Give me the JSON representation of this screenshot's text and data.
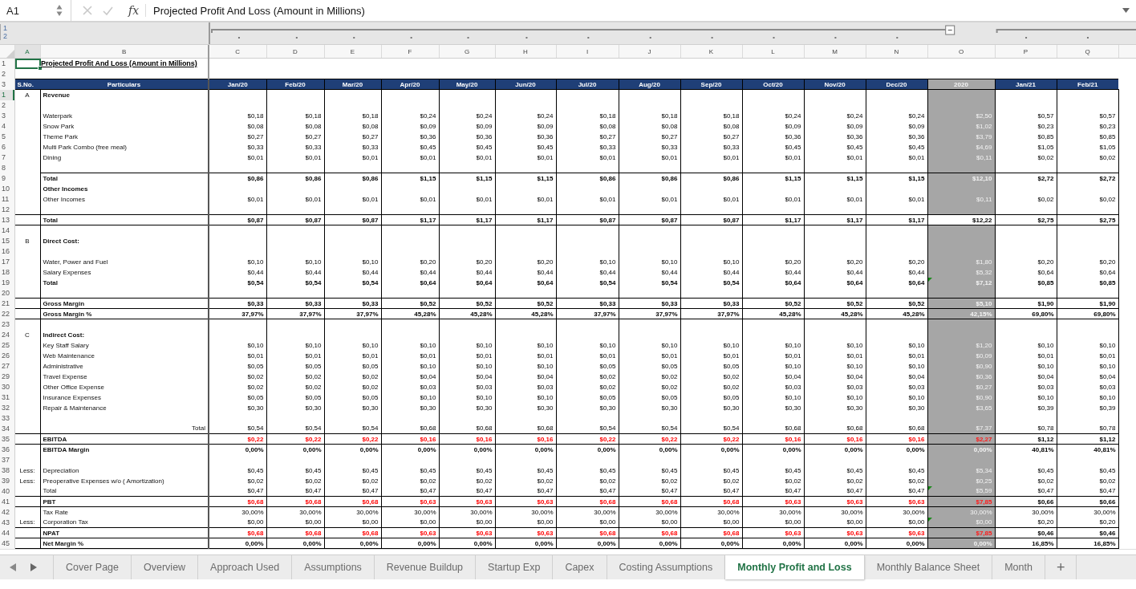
{
  "formula_bar": {
    "cell_ref": "A1",
    "function_label": "fx",
    "formula": "Projected Profit And Loss (Amount in Millions)"
  },
  "outline": {
    "levels": [
      "1",
      "2"
    ]
  },
  "columns": [
    {
      "letter": "A",
      "selected": true
    },
    {
      "letter": "B",
      "selected": false
    },
    {
      "letter": "C",
      "selected": false
    },
    {
      "letter": "D",
      "selected": false
    },
    {
      "letter": "E",
      "selected": false
    },
    {
      "letter": "F",
      "selected": false
    },
    {
      "letter": "G",
      "selected": false
    },
    {
      "letter": "H",
      "selected": false
    },
    {
      "letter": "I",
      "selected": false
    },
    {
      "letter": "J",
      "selected": false
    },
    {
      "letter": "K",
      "selected": false
    },
    {
      "letter": "L",
      "selected": false
    },
    {
      "letter": "M",
      "selected": false
    },
    {
      "letter": "N",
      "selected": false
    },
    {
      "letter": "O",
      "selected": false
    },
    {
      "letter": "P",
      "selected": false
    },
    {
      "letter": "Q",
      "selected": false
    }
  ],
  "value_columns": [
    {
      "header": "Jan/20",
      "shaded": false
    },
    {
      "header": "Feb/20",
      "shaded": false
    },
    {
      "header": "Mar/20",
      "shaded": false
    },
    {
      "header": "Apr/20",
      "shaded": false
    },
    {
      "header": "May/20",
      "shaded": false
    },
    {
      "header": "Jun/20",
      "shaded": false
    },
    {
      "header": "Jul/20",
      "shaded": false
    },
    {
      "header": "Aug/20",
      "shaded": false
    },
    {
      "header": "Sep/20",
      "shaded": false
    },
    {
      "header": "Oct/20",
      "shaded": false
    },
    {
      "header": "Nov/20",
      "shaded": false
    },
    {
      "header": "Dec/20",
      "shaded": false
    },
    {
      "header": "2020",
      "shaded": true
    },
    {
      "header": "Jan/21",
      "shaded": false
    },
    {
      "header": "Feb/21",
      "shaded": false
    }
  ],
  "rows": [
    {
      "row": "1",
      "kind": "title",
      "label": "Projected Profit And Loss (Amount in Millions)",
      "selected": false
    },
    {
      "row": "2",
      "kind": "spacer",
      "selected": false
    },
    {
      "row": "3",
      "kind": "header",
      "sno": "S.No.",
      "label": "Particulars",
      "selected": false
    },
    {
      "row": "1",
      "kind": "section",
      "sno": "A",
      "label": "Revenue",
      "selected": true
    },
    {
      "row": "2",
      "kind": "blank",
      "selected": false
    },
    {
      "row": "3",
      "kind": "item",
      "label": "Waterpark",
      "selected": false,
      "flagged": false,
      "values": [
        "$0,18",
        "$0,18",
        "$0,18",
        "$0,24",
        "$0,24",
        "$0,24",
        "$0,18",
        "$0,18",
        "$0,18",
        "$0,24",
        "$0,24",
        "$0,24",
        "$2,50",
        "$0,57",
        "$0,57"
      ]
    },
    {
      "row": "4",
      "kind": "item",
      "label": "Snow Park",
      "selected": false,
      "flagged": false,
      "values": [
        "$0,08",
        "$0,08",
        "$0,08",
        "$0,09",
        "$0,09",
        "$0,09",
        "$0,08",
        "$0,08",
        "$0,08",
        "$0,09",
        "$0,09",
        "$0,09",
        "$1,02",
        "$0,23",
        "$0,23"
      ]
    },
    {
      "row": "5",
      "kind": "item",
      "label": "Theme Park",
      "selected": false,
      "flagged": false,
      "values": [
        "$0,27",
        "$0,27",
        "$0,27",
        "$0,36",
        "$0,36",
        "$0,36",
        "$0,27",
        "$0,27",
        "$0,27",
        "$0,36",
        "$0,36",
        "$0,36",
        "$3,79",
        "$0,85",
        "$0,85"
      ]
    },
    {
      "row": "6",
      "kind": "item",
      "label": "Multi Park Combo (free meal)",
      "selected": false,
      "flagged": false,
      "values": [
        "$0,33",
        "$0,33",
        "$0,33",
        "$0,45",
        "$0,45",
        "$0,45",
        "$0,33",
        "$0,33",
        "$0,33",
        "$0,45",
        "$0,45",
        "$0,45",
        "$4,69",
        "$1,05",
        "$1,05"
      ]
    },
    {
      "row": "7",
      "kind": "item",
      "label": "Dining",
      "selected": false,
      "flagged": false,
      "values": [
        "$0,01",
        "$0,01",
        "$0,01",
        "$0,01",
        "$0,01",
        "$0,01",
        "$0,01",
        "$0,01",
        "$0,01",
        "$0,01",
        "$0,01",
        "$0,01",
        "$0,11",
        "$0,02",
        "$0,02"
      ]
    },
    {
      "row": "8",
      "kind": "blank",
      "selected": false
    },
    {
      "row": "9",
      "kind": "subtotal",
      "label": "Total",
      "selected": false,
      "flagged": false,
      "values": [
        "$0,86",
        "$0,86",
        "$0,86",
        "$1,15",
        "$1,15",
        "$1,15",
        "$0,86",
        "$0,86",
        "$0,86",
        "$1,15",
        "$1,15",
        "$1,15",
        "$12,10",
        "$2,72",
        "$2,72"
      ]
    },
    {
      "row": "10",
      "kind": "section",
      "label": "Other Incomes",
      "selected": false
    },
    {
      "row": "11",
      "kind": "item",
      "label": "Other Incomes",
      "selected": false,
      "flagged": false,
      "values": [
        "$0,01",
        "$0,01",
        "$0,01",
        "$0,01",
        "$0,01",
        "$0,01",
        "$0,01",
        "$0,01",
        "$0,01",
        "$0,01",
        "$0,01",
        "$0,01",
        "$0,11",
        "$0,02",
        "$0,02"
      ]
    },
    {
      "row": "12",
      "kind": "blank",
      "selected": false
    },
    {
      "row": "13",
      "kind": "grand_total",
      "label": "Total",
      "selected": false,
      "flagged": false,
      "values": [
        "$0,87",
        "$0,87",
        "$0,87",
        "$1,17",
        "$1,17",
        "$1,17",
        "$0,87",
        "$0,87",
        "$0,87",
        "$1,17",
        "$1,17",
        "$1,17",
        "$12,22",
        "$2,75",
        "$2,75"
      ]
    },
    {
      "row": "14",
      "kind": "blank",
      "selected": false
    },
    {
      "row": "15",
      "kind": "section",
      "sno": "B",
      "label": "Direct Cost:",
      "selected": false
    },
    {
      "row": "16",
      "kind": "blank",
      "selected": false
    },
    {
      "row": "17",
      "kind": "item",
      "label": "Water, Power and Fuel",
      "selected": false,
      "flagged": false,
      "values": [
        "$0,10",
        "$0,10",
        "$0,10",
        "$0,20",
        "$0,20",
        "$0,20",
        "$0,10",
        "$0,10",
        "$0,10",
        "$0,20",
        "$0,20",
        "$0,20",
        "$1,80",
        "$0,20",
        "$0,20"
      ]
    },
    {
      "row": "18",
      "kind": "item",
      "label": "Salary Expenses",
      "selected": false,
      "flagged": false,
      "values": [
        "$0,44",
        "$0,44",
        "$0,44",
        "$0,44",
        "$0,44",
        "$0,44",
        "$0,44",
        "$0,44",
        "$0,44",
        "$0,44",
        "$0,44",
        "$0,44",
        "$5,32",
        "$0,64",
        "$0,64"
      ]
    },
    {
      "row": "19",
      "kind": "sum",
      "label": "Total",
      "selected": false,
      "flagged": true,
      "values": [
        "$0,54",
        "$0,54",
        "$0,54",
        "$0,64",
        "$0,64",
        "$0,64",
        "$0,54",
        "$0,54",
        "$0,54",
        "$0,64",
        "$0,64",
        "$0,64",
        "$7,12",
        "$0,85",
        "$0,85"
      ]
    },
    {
      "row": "20",
      "kind": "blank",
      "selected": false
    },
    {
      "row": "21",
      "kind": "total",
      "label": "Gross Margin",
      "selected": false,
      "flagged": false,
      "values": [
        "$0,33",
        "$0,33",
        "$0,33",
        "$0,52",
        "$0,52",
        "$0,52",
        "$0,33",
        "$0,33",
        "$0,33",
        "$0,52",
        "$0,52",
        "$0,52",
        "$5,10",
        "$1,90",
        "$1,90"
      ]
    },
    {
      "row": "22",
      "kind": "total",
      "label": "Gross Margin %",
      "selected": false,
      "flagged": false,
      "values": [
        "37,97%",
        "37,97%",
        "37,97%",
        "45,28%",
        "45,28%",
        "45,28%",
        "37,97%",
        "37,97%",
        "37,97%",
        "45,28%",
        "45,28%",
        "45,28%",
        "42,15%",
        "69,80%",
        "69,80%"
      ]
    },
    {
      "row": "23",
      "kind": "blank",
      "selected": false
    },
    {
      "row": "24",
      "kind": "section",
      "sno": "C",
      "label": "Indirect Cost:",
      "selected": false
    },
    {
      "row": "25",
      "kind": "item",
      "label": "Key Staff Salary",
      "selected": false,
      "flagged": false,
      "values": [
        "$0,10",
        "$0,10",
        "$0,10",
        "$0,10",
        "$0,10",
        "$0,10",
        "$0,10",
        "$0,10",
        "$0,10",
        "$0,10",
        "$0,10",
        "$0,10",
        "$1,20",
        "$0,10",
        "$0,10"
      ]
    },
    {
      "row": "26",
      "kind": "item",
      "label": "Web Maintenance",
      "selected": false,
      "flagged": false,
      "values": [
        "$0,01",
        "$0,01",
        "$0,01",
        "$0,01",
        "$0,01",
        "$0,01",
        "$0,01",
        "$0,01",
        "$0,01",
        "$0,01",
        "$0,01",
        "$0,01",
        "$0,09",
        "$0,01",
        "$0,01"
      ]
    },
    {
      "row": "27",
      "kind": "item",
      "label": "Administrative",
      "selected": false,
      "flagged": false,
      "values": [
        "$0,05",
        "$0,05",
        "$0,05",
        "$0,10",
        "$0,10",
        "$0,10",
        "$0,05",
        "$0,05",
        "$0,05",
        "$0,10",
        "$0,10",
        "$0,10",
        "$0,90",
        "$0,10",
        "$0,10"
      ]
    },
    {
      "row": "29",
      "kind": "item",
      "label": "Travel Expense",
      "selected": false,
      "flagged": false,
      "values": [
        "$0,02",
        "$0,02",
        "$0,02",
        "$0,04",
        "$0,04",
        "$0,04",
        "$0,02",
        "$0,02",
        "$0,02",
        "$0,04",
        "$0,04",
        "$0,04",
        "$0,36",
        "$0,04",
        "$0,04"
      ]
    },
    {
      "row": "30",
      "kind": "item",
      "label": "Other Office Expense",
      "selected": false,
      "flagged": false,
      "values": [
        "$0,02",
        "$0,02",
        "$0,02",
        "$0,03",
        "$0,03",
        "$0,03",
        "$0,02",
        "$0,02",
        "$0,02",
        "$0,03",
        "$0,03",
        "$0,03",
        "$0,27",
        "$0,03",
        "$0,03"
      ]
    },
    {
      "row": "31",
      "kind": "item",
      "label": "Insurance Expenses",
      "selected": false,
      "flagged": false,
      "values": [
        "$0,05",
        "$0,05",
        "$0,05",
        "$0,10",
        "$0,10",
        "$0,10",
        "$0,05",
        "$0,05",
        "$0,05",
        "$0,10",
        "$0,10",
        "$0,10",
        "$0,90",
        "$0,10",
        "$0,10"
      ]
    },
    {
      "row": "32",
      "kind": "item",
      "label": "Repair & Maintenance",
      "selected": false,
      "flagged": false,
      "values": [
        "$0,30",
        "$0,30",
        "$0,30",
        "$0,30",
        "$0,30",
        "$0,30",
        "$0,30",
        "$0,30",
        "$0,30",
        "$0,30",
        "$0,30",
        "$0,30",
        "$3,65",
        "$0,39",
        "$0,39"
      ]
    },
    {
      "row": "33",
      "kind": "blank",
      "selected": false
    },
    {
      "row": "34",
      "kind": "total_right",
      "label": "Total",
      "selected": false,
      "flagged": false,
      "values": [
        "$0,54",
        "$0,54",
        "$0,54",
        "$0,68",
        "$0,68",
        "$0,68",
        "$0,54",
        "$0,54",
        "$0,54",
        "$0,68",
        "$0,68",
        "$0,68",
        "$7,37",
        "$0,78",
        "$0,78"
      ]
    },
    {
      "row": "35",
      "kind": "total",
      "label": "EBITDA",
      "selected": false,
      "flagged": false,
      "values": [
        "$0,22",
        "$0,22",
        "$0,22",
        "$0,16",
        "$0,16",
        "$0,16",
        "$0,22",
        "$0,22",
        "$0,22",
        "$0,16",
        "$0,16",
        "$0,16",
        "$2,27",
        "$1,12",
        "$1,12"
      ],
      "negative": [
        true,
        true,
        true,
        true,
        true,
        true,
        true,
        true,
        true,
        true,
        true,
        true,
        true,
        false,
        false
      ]
    },
    {
      "row": "36",
      "kind": "sum",
      "label": "EBITDA Margin",
      "selected": false,
      "flagged": false,
      "values": [
        "0,00%",
        "0,00%",
        "0,00%",
        "0,00%",
        "0,00%",
        "0,00%",
        "0,00%",
        "0,00%",
        "0,00%",
        "0,00%",
        "0,00%",
        "0,00%",
        "0,00%",
        "40,81%",
        "40,81%"
      ]
    },
    {
      "row": "37",
      "kind": "blank",
      "selected": false
    },
    {
      "row": "38",
      "kind": "item",
      "sno": "Less:",
      "label": "Depreciation",
      "selected": false,
      "flagged": false,
      "values": [
        "$0,45",
        "$0,45",
        "$0,45",
        "$0,45",
        "$0,45",
        "$0,45",
        "$0,45",
        "$0,45",
        "$0,45",
        "$0,45",
        "$0,45",
        "$0,45",
        "$5,34",
        "$0,45",
        "$0,45"
      ]
    },
    {
      "row": "39",
      "kind": "item",
      "sno": "Less:",
      "label": "Preoperative Expenses w/o ( Amortization)",
      "selected": false,
      "flagged": false,
      "values": [
        "$0,02",
        "$0,02",
        "$0,02",
        "$0,02",
        "$0,02",
        "$0,02",
        "$0,02",
        "$0,02",
        "$0,02",
        "$0,02",
        "$0,02",
        "$0,02",
        "$0,25",
        "$0,02",
        "$0,02"
      ]
    },
    {
      "row": "40",
      "kind": "item",
      "label": "Total",
      "selected": false,
      "flagged": true,
      "values": [
        "$0,47",
        "$0,47",
        "$0,47",
        "$0,47",
        "$0,47",
        "$0,47",
        "$0,47",
        "$0,47",
        "$0,47",
        "$0,47",
        "$0,47",
        "$0,47",
        "$5,59",
        "$0,47",
        "$0,47"
      ]
    },
    {
      "row": "41",
      "kind": "total",
      "label": "PBT",
      "selected": false,
      "flagged": false,
      "values": [
        "$0,68",
        "$0,68",
        "$0,68",
        "$0,63",
        "$0,63",
        "$0,63",
        "$0,68",
        "$0,68",
        "$0,68",
        "$0,63",
        "$0,63",
        "$0,63",
        "$7,85",
        "$0,66",
        "$0,66"
      ],
      "negative": [
        true,
        true,
        true,
        true,
        true,
        true,
        true,
        true,
        true,
        true,
        true,
        true,
        true,
        false,
        false
      ]
    },
    {
      "row": "42",
      "kind": "item",
      "label": "Tax Rate",
      "selected": false,
      "flagged": false,
      "values": [
        "30,00%",
        "30,00%",
        "30,00%",
        "30,00%",
        "30,00%",
        "30,00%",
        "30,00%",
        "30,00%",
        "30,00%",
        "30,00%",
        "30,00%",
        "30,00%",
        "30,00%",
        "30,00%",
        "30,00%"
      ]
    },
    {
      "row": "43",
      "kind": "item",
      "sno": "Less:",
      "label": "Corporation Tax",
      "selected": false,
      "flagged": true,
      "values": [
        "$0,00",
        "$0,00",
        "$0,00",
        "$0,00",
        "$0,00",
        "$0,00",
        "$0,00",
        "$0,00",
        "$0,00",
        "$0,00",
        "$0,00",
        "$0,00",
        "$0,00",
        "$0,20",
        "$0,20"
      ]
    },
    {
      "row": "44",
      "kind": "total",
      "label": "NPAT",
      "selected": false,
      "flagged": false,
      "values": [
        "$0,68",
        "$0,68",
        "$0,68",
        "$0,63",
        "$0,63",
        "$0,63",
        "$0,68",
        "$0,68",
        "$0,68",
        "$0,63",
        "$0,63",
        "$0,63",
        "$7,85",
        "$0,46",
        "$0,46"
      ],
      "negative": [
        true,
        true,
        true,
        true,
        true,
        true,
        true,
        true,
        true,
        true,
        true,
        true,
        true,
        false,
        false
      ]
    },
    {
      "row": "45",
      "kind": "total",
      "label": "Net Margin %",
      "selected": false,
      "flagged": false,
      "values": [
        "0,00%",
        "0,00%",
        "0,00%",
        "0,00%",
        "0,00%",
        "0,00%",
        "0,00%",
        "0,00%",
        "0,00%",
        "0,00%",
        "0,00%",
        "0,00%",
        "0,00%",
        "16,85%",
        "16,85%"
      ]
    }
  ],
  "tabs": [
    {
      "label": "Cover Page",
      "selected": false
    },
    {
      "label": "Overview",
      "selected": false
    },
    {
      "label": "Approach Used",
      "selected": false
    },
    {
      "label": "Assumptions",
      "selected": false
    },
    {
      "label": "Revenue Buildup",
      "selected": false
    },
    {
      "label": "Startup Exp",
      "selected": false
    },
    {
      "label": "Capex",
      "selected": false
    },
    {
      "label": "Costing Assumptions",
      "selected": false
    },
    {
      "label": "Monthly Profit and Loss",
      "selected": true
    },
    {
      "label": "Monthly Balance Sheet",
      "selected": false
    },
    {
      "label": "Month",
      "selected": false
    }
  ],
  "add_sheet": "+"
}
